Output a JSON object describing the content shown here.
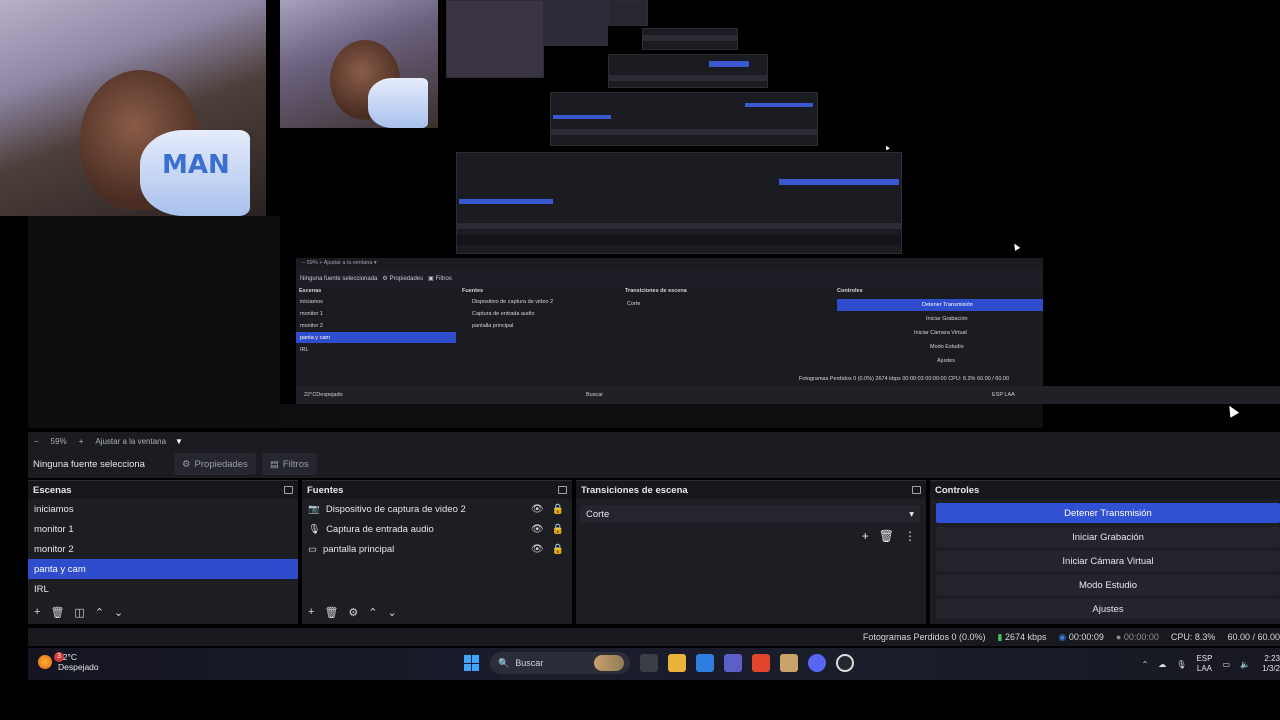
{
  "preview": {
    "nested_zoom": "59%",
    "nested_fit": "Ajustar a la ventana",
    "nested_none": "Ninguna fuente seleccionada",
    "nested_props": "Propiedades",
    "nested_filters": "Filtros",
    "cup_text": "MAN",
    "nested_scenes_title": "Escenas",
    "nested_sources_title": "Fuentes",
    "nested_transitions_title": "Transiciones de escena",
    "nested_controls_title": "Controles",
    "nested_scenes": [
      "iniciamos",
      "monitor 1",
      "monitor 2",
      "panta y cam",
      "IRL"
    ],
    "nested_sources": [
      "Dispositivo de captura de video 2",
      "Captura de entrada audio",
      "pantalla principal"
    ],
    "nested_transition": "Corte",
    "nested_controls": [
      "Detener Transmisión",
      "Iniciar Grabación",
      "Iniciar Cámara Virtual",
      "Modo Estudio",
      "Ajustes"
    ],
    "nested_status": "Fotogramas Perdidos 0 (0.0%)   2674 kbps   00:00:03   00:00:00   CPU: 8.3%   60.00 / 60.00",
    "nested_weather_temp": "22°C",
    "nested_weather_desc": "Despejado",
    "nested_search": "Buscar",
    "nested_lang": "ESP LAA"
  },
  "zoombar": {
    "minus": "−",
    "zoom": "59%",
    "plus": "+",
    "fit": "Ajustar a la ventana"
  },
  "selection_bar": {
    "none": "Ninguna fuente selecciona",
    "properties": "Propiedades",
    "filters": "Filtros"
  },
  "scenes": {
    "title": "Escenas",
    "items": [
      {
        "label": "iniciamos",
        "selected": false
      },
      {
        "label": "monitor 1",
        "selected": false
      },
      {
        "label": "monitor 2",
        "selected": false
      },
      {
        "label": "panta y cam",
        "selected": true
      },
      {
        "label": "IRL",
        "selected": false
      }
    ]
  },
  "sources": {
    "title": "Fuentes",
    "items": [
      {
        "label": "Dispositivo de captura de video 2",
        "icon": "camera-icon"
      },
      {
        "label": "Captura de entrada audio",
        "icon": "microphone-icon"
      },
      {
        "label": "pantalla principal",
        "icon": "monitor-icon"
      }
    ]
  },
  "transitions": {
    "title": "Transiciones de escena",
    "selected": "Corte"
  },
  "controls": {
    "title": "Controles",
    "buttons": [
      "Detener Transmisión",
      "Iniciar Grabación",
      "Iniciar Cámara Virtual",
      "Modo Estudio",
      "Ajustes"
    ]
  },
  "status": {
    "dropped": "Fotogramas Perdidos 0 (0.0%)",
    "bitrate": "2674 kbps",
    "stream_time": "00:00:09",
    "record_time": "00:00:00",
    "cpu": "CPU: 8.3%",
    "fps": "60.00 / 60.00"
  },
  "taskbar": {
    "weather_badge": "3",
    "temp": "22°C",
    "weather": "Despejado",
    "search": "Buscar",
    "lang_top": "ESP",
    "lang_bottom": "LAA",
    "time": "2:23",
    "date": "1/3/2"
  },
  "colors": {
    "accent": "#3051d2",
    "panel": "#1d1e24",
    "bitrate_green": "#46c35a"
  }
}
